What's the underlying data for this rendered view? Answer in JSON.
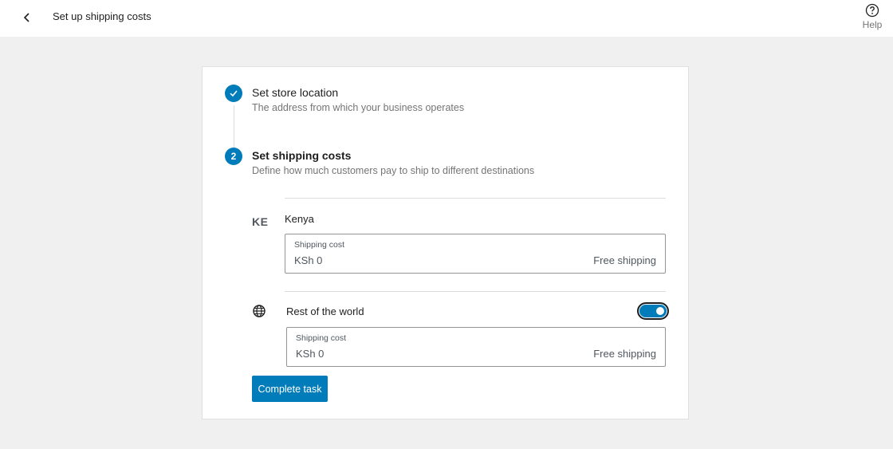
{
  "header": {
    "title": "Set up shipping costs",
    "help_label": "Help"
  },
  "steps": [
    {
      "number": "",
      "status": "complete",
      "title": "Set store location",
      "description": "The address from which your business operates"
    },
    {
      "number": "2",
      "status": "active",
      "title": "Set shipping costs",
      "description": "Define how much customers pay to ship to different destinations"
    }
  ],
  "zones": [
    {
      "code": "KE",
      "name": "Kenya",
      "cost_label": "Shipping cost",
      "cost_value": "KSh 0",
      "free_label": "Free shipping"
    },
    {
      "icon": "globe-icon",
      "name": "Rest of the world",
      "enabled": true,
      "cost_label": "Shipping cost",
      "cost_value": "KSh 0",
      "free_label": "Free shipping"
    }
  ],
  "actions": {
    "complete_label": "Complete task"
  },
  "colors": {
    "accent": "#007cba",
    "background": "#f0f0f1"
  }
}
